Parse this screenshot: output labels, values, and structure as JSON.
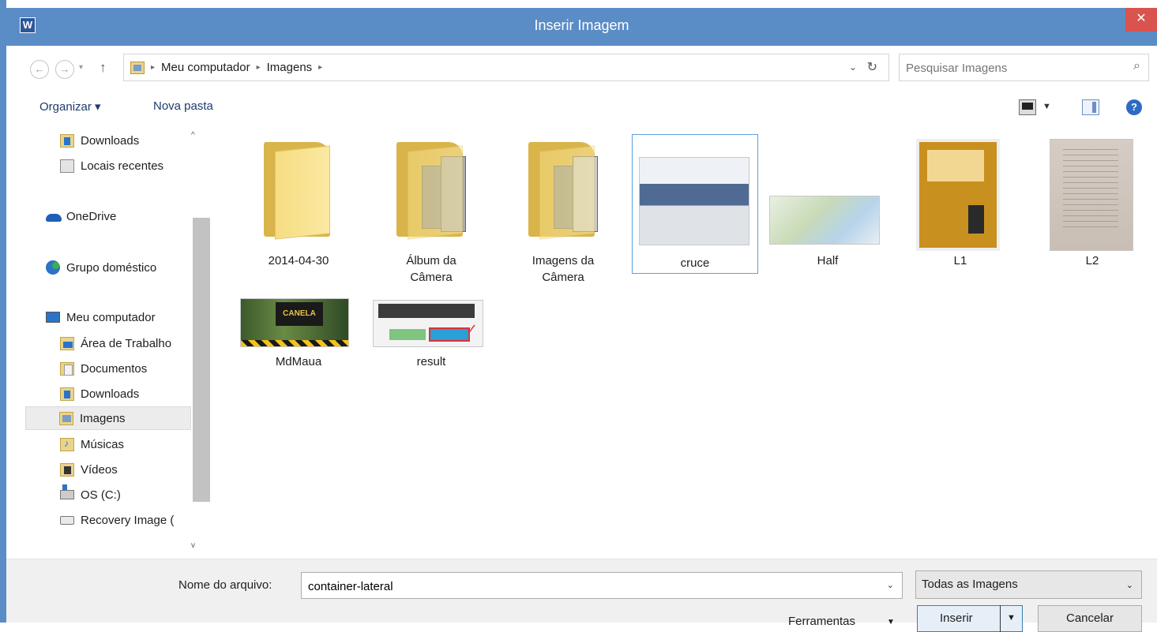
{
  "window": {
    "title": "Inserir Imagem",
    "app_icon_letter": "W",
    "close_glyph": "✕",
    "accent_color": "#5a8cc6"
  },
  "navigation": {
    "back_glyph": "←",
    "forward_glyph": "→",
    "dropdown_glyph": "▾",
    "up_glyph": "↑",
    "breadcrumb": [
      "Meu computador",
      "Imagens"
    ],
    "separator_glyph": "▸",
    "address_dropdown_glyph": "⌄",
    "refresh_glyph": "↻",
    "search_placeholder": "Pesquisar Imagens",
    "search_glyph": "⌕"
  },
  "toolbar": {
    "organize_label": "Organizar ▾",
    "new_folder_label": "Nova pasta",
    "view_dropdown_glyph": "▼",
    "help_glyph": "?"
  },
  "sidebar": {
    "items": [
      {
        "label": "Downloads",
        "icon": "downloads-folder-icon"
      },
      {
        "label": "Locais recentes",
        "icon": "recent-places-icon"
      },
      {
        "label": "OneDrive",
        "icon": "onedrive-icon"
      },
      {
        "label": "Grupo doméstico",
        "icon": "homegroup-icon"
      },
      {
        "label": "Meu computador",
        "icon": "computer-icon"
      },
      {
        "label": "Área de Trabalho",
        "icon": "desktop-folder-icon"
      },
      {
        "label": "Documentos",
        "icon": "documents-folder-icon"
      },
      {
        "label": "Downloads",
        "icon": "downloads-folder-icon"
      },
      {
        "label": "Imagens",
        "icon": "pictures-folder-icon",
        "selected": true
      },
      {
        "label": "Músicas",
        "icon": "music-folder-icon"
      },
      {
        "label": "Vídeos",
        "icon": "videos-folder-icon"
      },
      {
        "label": "OS (C:)",
        "icon": "drive-icon"
      },
      {
        "label": "Recovery Image (",
        "icon": "recovery-drive-icon"
      }
    ],
    "scroll_up_glyph": "^",
    "scroll_down_glyph": "v"
  },
  "files": [
    {
      "name": "2014-04-30",
      "kind": "folder"
    },
    {
      "name": "Álbum da Câmera",
      "kind": "folder"
    },
    {
      "name": "Imagens da Câmera",
      "kind": "folder"
    },
    {
      "name": "cruce",
      "kind": "image",
      "selected": true
    },
    {
      "name": "Half",
      "kind": "image"
    },
    {
      "name": "L1",
      "kind": "image"
    },
    {
      "name": "L2",
      "kind": "image"
    },
    {
      "name": "MdMaua",
      "kind": "image"
    },
    {
      "name": "result",
      "kind": "image"
    }
  ],
  "bottom": {
    "filename_label": "Nome do arquivo:",
    "filename_value": "container-lateral",
    "filename_dropdown_glyph": "⌄",
    "filetype_value": "Todas as Imagens",
    "filetype_dropdown_glyph": "⌄",
    "tools_label": "Ferramentas",
    "tools_dropdown_glyph": "▼",
    "insert_label": "Inserir",
    "insert_dropdown_glyph": "▼",
    "cancel_label": "Cancelar"
  },
  "thumb_text": {
    "mdmaua_banner": "CANELA"
  }
}
